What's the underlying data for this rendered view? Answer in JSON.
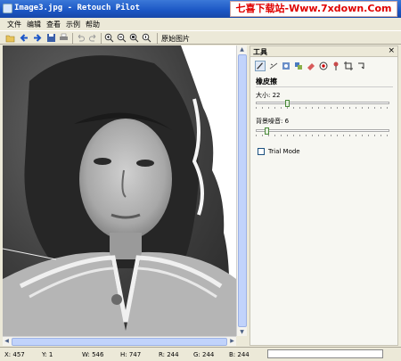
{
  "window": {
    "title": "Image3.jpg - Retouch Pilot",
    "watermark": "七喜下载站-Www.7xdown.Com"
  },
  "menu": [
    "文件",
    "编辑",
    "查看",
    "示例",
    "帮助"
  ],
  "toolbar": {
    "buttons": [
      "open-icon",
      "back-icon",
      "forward-icon",
      "save-icon",
      "print-icon",
      "undo-icon",
      "redo-icon",
      "zoom-in-icon",
      "zoom-out-icon",
      "zoom-fit-icon",
      "zoom-actual-icon"
    ],
    "original_label": "原始图片"
  },
  "panel": {
    "title": "工具",
    "close": "×",
    "tools": [
      "brush-icon",
      "scratch-icon",
      "stamp-icon",
      "patch-icon",
      "eraser-icon",
      "redeye-icon",
      "pin-icon",
      "crop-icon",
      "rotate-icon"
    ],
    "section": "橡皮擦",
    "size_label": "大小: 22",
    "size_value": 22,
    "size_max": 100,
    "noise_label": "背景噪音: 6",
    "noise_value": 6,
    "noise_max": 100,
    "trial_mode": "Trial Mode",
    "trial_checked": false
  },
  "status": {
    "x": "X: 457",
    "y": "Y: 1",
    "w": "W: 546",
    "h": "H: 747",
    "r": "R: 244",
    "g": "G: 244",
    "b": "B: 244",
    "progress": 0
  },
  "colors": {
    "title_bar": "#1b56c4",
    "watermark_text": "#e00000"
  }
}
